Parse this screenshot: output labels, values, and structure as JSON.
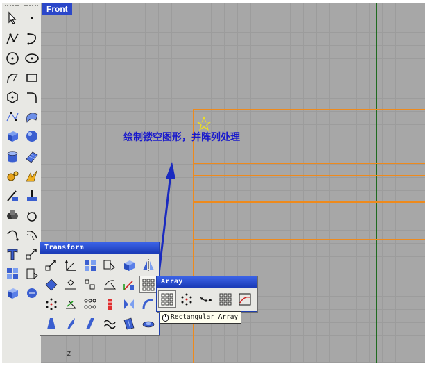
{
  "viewport": {
    "title": "Front",
    "axis_label": "z",
    "annotation": "绘制镂空图形，并阵列处理"
  },
  "colors": {
    "viewport_bg": "#a7a7a7",
    "grid": "#9c9c9c",
    "title_bg": "#2b47c9",
    "curve": "#ee8a1c",
    "vertical_axis": "#1f6b1f",
    "annotation": "#1a1acc",
    "arrow": "#1a2ac0"
  },
  "left_toolbar": {
    "icons": [
      "select-arrow-icon",
      "point-icon",
      "polyline-icon",
      "curve-icon",
      "circle-icon",
      "ellipse-icon",
      "arc-icon",
      "rectangle-icon",
      "polygon-icon",
      "fillet-icon",
      "control-point-curve-icon",
      "surface-icon",
      "box-icon",
      "sphere-icon",
      "cylinder-icon",
      "plane-surface-icon",
      "explode-gear-icon",
      "boolean-icon",
      "split-icon",
      "extend-icon",
      "boolean-union-icon",
      "offset-icon",
      "rotate-curve-icon",
      "offset-curve-icon",
      "text-icon",
      "transform-icon",
      "group-icon",
      "dimension-icon",
      "block-icon",
      "render-icon"
    ]
  },
  "transform_popup": {
    "title": "Transform",
    "icons": [
      "move-icon",
      "scale-icon",
      "array-icon",
      "mirror-icon",
      "box-3d-icon",
      "flip-icon",
      "diamond-icon",
      "rotate-3d-icon",
      "align-icon",
      "bend-icon",
      "orient-icon",
      "array-grid-icon",
      "polar-icon",
      "shear-icon",
      "flow-icon",
      "twist-icon",
      "mirror-plane-icon",
      "splop-icon",
      "taper-icon",
      "stretch-icon",
      "project-icon",
      "wave-icon",
      "cage-icon",
      "smash-icon"
    ]
  },
  "array_popup": {
    "title": "Array",
    "icons": [
      "rectangular-array-icon",
      "polar-array-icon",
      "array-curve-icon",
      "array-surface-icon",
      "array-crv-on-srf-icon"
    ],
    "tooltip": "Rectangular Array"
  }
}
